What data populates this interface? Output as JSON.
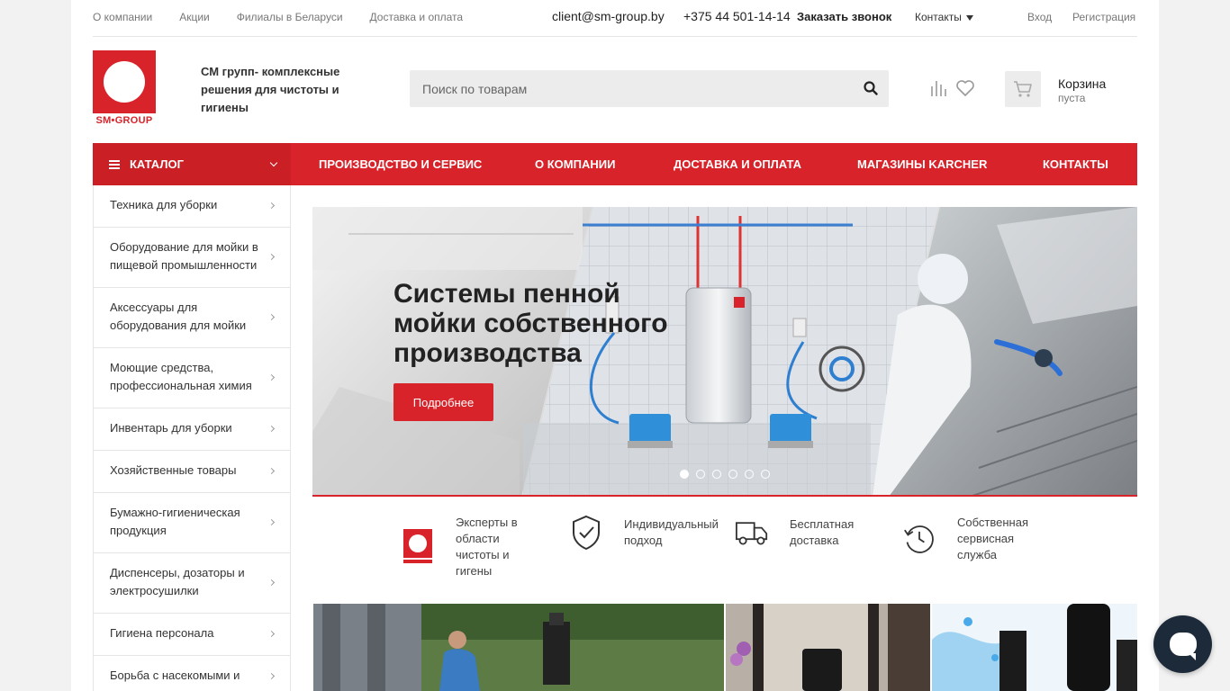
{
  "topbar": {
    "links": [
      "О компании",
      "Акции",
      "Филиалы в Беларуси",
      "Доставка и оплата"
    ],
    "email": "client@sm-group.by",
    "phone": "+375 44 501-14-14",
    "callback": "Заказать звонок",
    "contacts": "Контакты",
    "login": "Вход",
    "register": "Регистрация"
  },
  "header": {
    "logo_text": "SM•GROUP",
    "tagline": "СМ групп- комплексные решения для чистоты и гигиены",
    "search_placeholder": "Поиск по товарам",
    "cart_title": "Корзина",
    "cart_status": "пуста"
  },
  "nav": {
    "catalog": "КАТАЛОГ",
    "items": [
      "ПРОИЗВОДСТВО И СЕРВИС",
      "О КОМПАНИИ",
      "ДОСТАВКА И ОПЛАТА",
      "МАГАЗИНЫ KARCHER",
      "КОНТАКТЫ"
    ]
  },
  "sidebar": {
    "items": [
      "Техника для уборки",
      "Оборудование для мойки в пищевой промышленности",
      "Аксессуары для оборудования для мойки",
      "Моющие средства, профессиональная химия",
      "Инвентарь для уборки",
      "Хозяйственные товары",
      "Бумажно-гигиеническая продукция",
      "Диспенсеры, дозаторы и электросушилки",
      "Гигиена персонала",
      "Борьба с насекомыми и"
    ]
  },
  "banner": {
    "title": "Системы пенной мойки собственного производства",
    "button": "Подробнее",
    "slides": 6,
    "active_slide": 1
  },
  "features": [
    {
      "icon": "sm-group-logo-icon",
      "text": "Эксперты в области чистоты и гигены"
    },
    {
      "icon": "shield-check-icon",
      "text": "Индивидуальный подход"
    },
    {
      "icon": "truck-icon",
      "text": "Бесплатная доставка"
    },
    {
      "icon": "clock-history-icon",
      "text": "Собственная сервисная служба"
    }
  ],
  "colors": {
    "brand_red": "#d8232a",
    "nav_dark_red": "#c91f25",
    "chat_button": "#1c2a3a"
  }
}
